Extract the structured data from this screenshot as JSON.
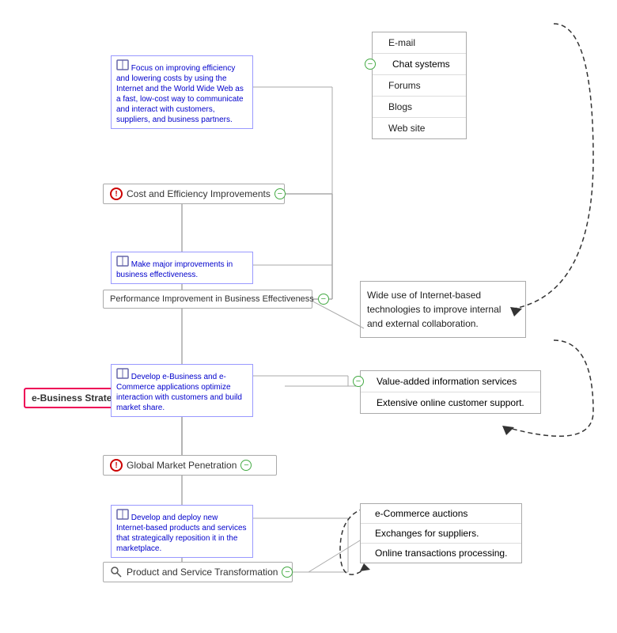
{
  "root": {
    "label": "e-Business Strategy"
  },
  "branches": [
    {
      "id": "cost",
      "label": "Cost and Efficiency Improvements",
      "icon": "exclaim",
      "note": "Focus on improving efficiency and lowering costs by using the Internet and the World Wide Web as a fast, low-cost way to communicate and interact with customers, suppliers, and business partners.",
      "subbranch": {
        "label": "Performance Improvement in Business Effectiveness",
        "note": "Make major improvements in business effectiveness."
      }
    },
    {
      "id": "global",
      "label": "Global Market Penetration",
      "icon": "exclaim",
      "note": "Develop e-Business and e-Commerce applications optimize interaction with customers and build market share.",
      "subbranch": null
    },
    {
      "id": "product",
      "label": "Product and Service Transformation",
      "icon": "magnify",
      "note": "Develop and deploy new Internet-based products and services that strategically reposition it in the marketplace.",
      "subbranch": null
    }
  ],
  "right_groups": [
    {
      "id": "email-group",
      "items": [
        "E-mail",
        "Chat systems",
        "Forums",
        "Blogs",
        "Web site"
      ]
    },
    {
      "id": "collab",
      "text": "Wide use of Internet-based technologies to improve internal and external collaboration."
    },
    {
      "id": "value-group",
      "items": [
        "Value-added information services",
        "Extensive online customer support."
      ]
    },
    {
      "id": "ecommerce-group",
      "items": [
        "e-Commerce auctions",
        "Exchanges for suppliers.",
        "Online transactions processing."
      ]
    }
  ],
  "icons": {
    "exclaim": "!",
    "book": "📖",
    "magnify": "🔍",
    "minus": "−"
  }
}
